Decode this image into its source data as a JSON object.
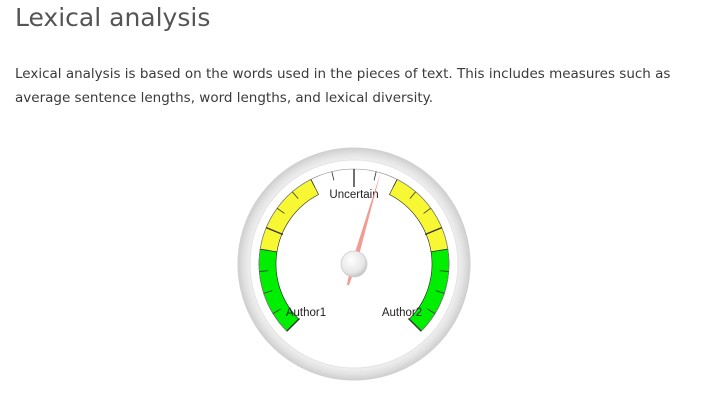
{
  "page": {
    "title": "Lexical analysis",
    "description": "Lexical analysis is based on the words used in the pieces of text. This includes measures such as average sentence lengths, word lengths, and lexical diversity."
  },
  "gauge": {
    "labels": {
      "left": "Author1",
      "center": "Uncertain",
      "right": "Author2"
    },
    "needle_value": 0.56,
    "bands": [
      {
        "from": 0.0,
        "to": 0.2,
        "color": "#00ee00"
      },
      {
        "from": 0.2,
        "to": 0.4,
        "color": "#f7f733"
      },
      {
        "from": 0.6,
        "to": 0.8,
        "color": "#f7f733"
      },
      {
        "from": 0.8,
        "to": 1.0,
        "color": "#00ee00"
      }
    ],
    "colors": {
      "needle": "#f08a80",
      "ticks": "#333333"
    }
  }
}
